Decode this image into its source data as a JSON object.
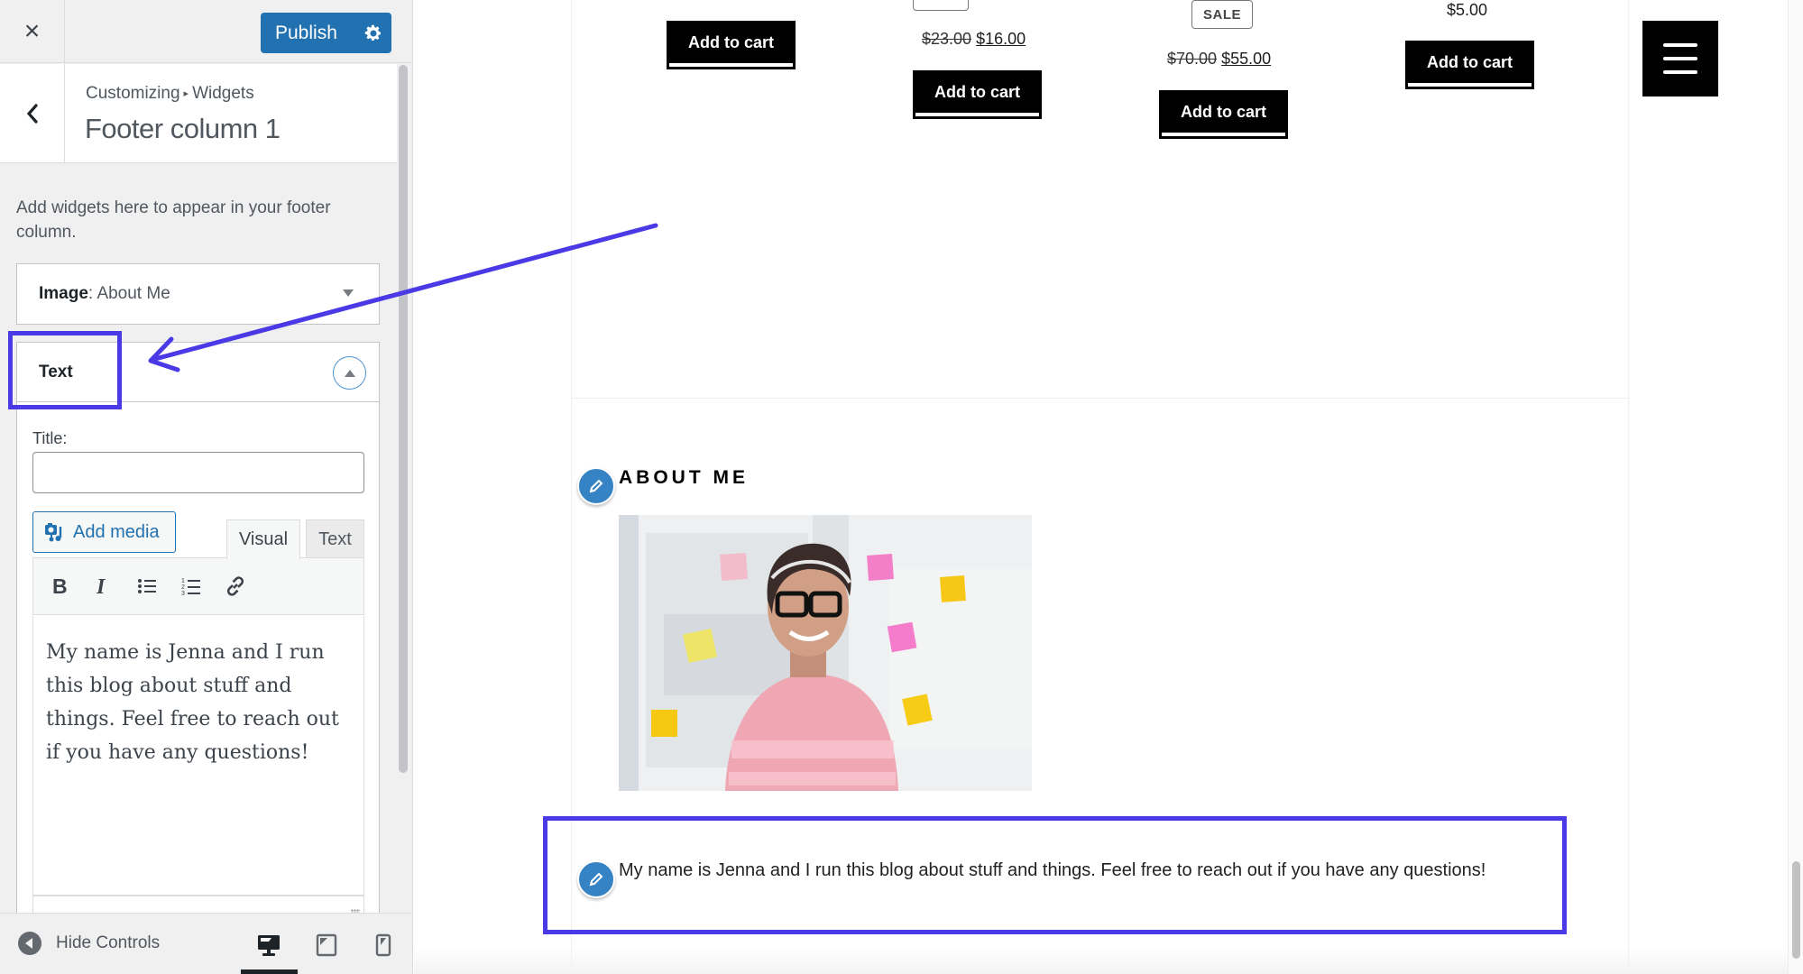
{
  "sidebar": {
    "close_label": "×",
    "publish_label": "Publish",
    "breadcrumb": {
      "root": "Customizing",
      "separator": "▸",
      "section": "Widgets"
    },
    "heading": "Footer column 1",
    "description": "Add widgets here to appear in your footer column.",
    "widgets": [
      {
        "type_label": "Image",
        "separator": ": ",
        "title": "About Me",
        "expanded": false
      },
      {
        "type_label": "Text",
        "expanded": true
      }
    ],
    "text_widget": {
      "title_label": "Title:",
      "title_value": "",
      "add_media_label": "Add media",
      "editor_tabs": [
        {
          "label": "Visual",
          "active": true
        },
        {
          "label": "Text",
          "active": false
        }
      ],
      "toolbar": [
        "bold-icon",
        "italic-icon",
        "bullet-list-icon",
        "numbered-list-icon",
        "link-icon"
      ],
      "content": "My name is Jenna and I run this blog about stuff and things. Feel free to reach out if you have any questions!"
    },
    "footer": {
      "hide_controls_label": "Hide Controls",
      "devices": [
        {
          "name": "desktop",
          "active": true
        },
        {
          "name": "tablet",
          "active": false
        },
        {
          "name": "mobile",
          "active": false
        }
      ]
    }
  },
  "preview": {
    "products": [
      {
        "price_old": null,
        "price_new": null,
        "sale": false,
        "button_label": "Add to cart"
      },
      {
        "price_old": "$23.00",
        "price_new": "$16.00",
        "sale": true,
        "button_label": "Add to cart"
      },
      {
        "price_old": "$70.00",
        "price_new": "$55.00",
        "sale": true,
        "sale_label": "SALE",
        "button_label": "Add to cart"
      },
      {
        "price": "$5.00",
        "sale": false,
        "button_label": "Add to cart"
      }
    ],
    "about": {
      "heading": "ABOUT ME",
      "image_alt": "Smiling woman with glasses and sticky notes",
      "text": "My name is Jenna and I run this blog about stuff and things. Feel free to reach out if you have any questions!"
    }
  },
  "annotations": {
    "highlight_color": "#4a3ae6"
  },
  "colors": {
    "primary": "#2271b1",
    "edit_shortcut": "#3582c4"
  }
}
